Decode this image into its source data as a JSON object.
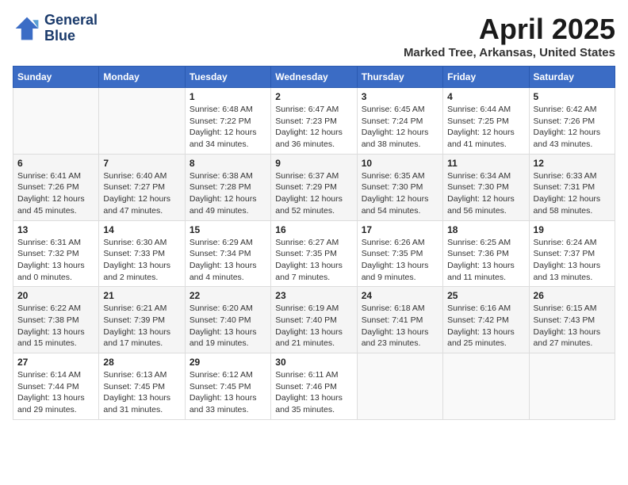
{
  "header": {
    "logo_line1": "General",
    "logo_line2": "Blue",
    "month_title": "April 2025",
    "location": "Marked Tree, Arkansas, United States"
  },
  "weekdays": [
    "Sunday",
    "Monday",
    "Tuesday",
    "Wednesday",
    "Thursday",
    "Friday",
    "Saturday"
  ],
  "weeks": [
    [
      {
        "day": null,
        "sunrise": null,
        "sunset": null,
        "daylight": null
      },
      {
        "day": null,
        "sunrise": null,
        "sunset": null,
        "daylight": null
      },
      {
        "day": "1",
        "sunrise": "Sunrise: 6:48 AM",
        "sunset": "Sunset: 7:22 PM",
        "daylight": "Daylight: 12 hours and 34 minutes."
      },
      {
        "day": "2",
        "sunrise": "Sunrise: 6:47 AM",
        "sunset": "Sunset: 7:23 PM",
        "daylight": "Daylight: 12 hours and 36 minutes."
      },
      {
        "day": "3",
        "sunrise": "Sunrise: 6:45 AM",
        "sunset": "Sunset: 7:24 PM",
        "daylight": "Daylight: 12 hours and 38 minutes."
      },
      {
        "day": "4",
        "sunrise": "Sunrise: 6:44 AM",
        "sunset": "Sunset: 7:25 PM",
        "daylight": "Daylight: 12 hours and 41 minutes."
      },
      {
        "day": "5",
        "sunrise": "Sunrise: 6:42 AM",
        "sunset": "Sunset: 7:26 PM",
        "daylight": "Daylight: 12 hours and 43 minutes."
      }
    ],
    [
      {
        "day": "6",
        "sunrise": "Sunrise: 6:41 AM",
        "sunset": "Sunset: 7:26 PM",
        "daylight": "Daylight: 12 hours and 45 minutes."
      },
      {
        "day": "7",
        "sunrise": "Sunrise: 6:40 AM",
        "sunset": "Sunset: 7:27 PM",
        "daylight": "Daylight: 12 hours and 47 minutes."
      },
      {
        "day": "8",
        "sunrise": "Sunrise: 6:38 AM",
        "sunset": "Sunset: 7:28 PM",
        "daylight": "Daylight: 12 hours and 49 minutes."
      },
      {
        "day": "9",
        "sunrise": "Sunrise: 6:37 AM",
        "sunset": "Sunset: 7:29 PM",
        "daylight": "Daylight: 12 hours and 52 minutes."
      },
      {
        "day": "10",
        "sunrise": "Sunrise: 6:35 AM",
        "sunset": "Sunset: 7:30 PM",
        "daylight": "Daylight: 12 hours and 54 minutes."
      },
      {
        "day": "11",
        "sunrise": "Sunrise: 6:34 AM",
        "sunset": "Sunset: 7:30 PM",
        "daylight": "Daylight: 12 hours and 56 minutes."
      },
      {
        "day": "12",
        "sunrise": "Sunrise: 6:33 AM",
        "sunset": "Sunset: 7:31 PM",
        "daylight": "Daylight: 12 hours and 58 minutes."
      }
    ],
    [
      {
        "day": "13",
        "sunrise": "Sunrise: 6:31 AM",
        "sunset": "Sunset: 7:32 PM",
        "daylight": "Daylight: 13 hours and 0 minutes."
      },
      {
        "day": "14",
        "sunrise": "Sunrise: 6:30 AM",
        "sunset": "Sunset: 7:33 PM",
        "daylight": "Daylight: 13 hours and 2 minutes."
      },
      {
        "day": "15",
        "sunrise": "Sunrise: 6:29 AM",
        "sunset": "Sunset: 7:34 PM",
        "daylight": "Daylight: 13 hours and 4 minutes."
      },
      {
        "day": "16",
        "sunrise": "Sunrise: 6:27 AM",
        "sunset": "Sunset: 7:35 PM",
        "daylight": "Daylight: 13 hours and 7 minutes."
      },
      {
        "day": "17",
        "sunrise": "Sunrise: 6:26 AM",
        "sunset": "Sunset: 7:35 PM",
        "daylight": "Daylight: 13 hours and 9 minutes."
      },
      {
        "day": "18",
        "sunrise": "Sunrise: 6:25 AM",
        "sunset": "Sunset: 7:36 PM",
        "daylight": "Daylight: 13 hours and 11 minutes."
      },
      {
        "day": "19",
        "sunrise": "Sunrise: 6:24 AM",
        "sunset": "Sunset: 7:37 PM",
        "daylight": "Daylight: 13 hours and 13 minutes."
      }
    ],
    [
      {
        "day": "20",
        "sunrise": "Sunrise: 6:22 AM",
        "sunset": "Sunset: 7:38 PM",
        "daylight": "Daylight: 13 hours and 15 minutes."
      },
      {
        "day": "21",
        "sunrise": "Sunrise: 6:21 AM",
        "sunset": "Sunset: 7:39 PM",
        "daylight": "Daylight: 13 hours and 17 minutes."
      },
      {
        "day": "22",
        "sunrise": "Sunrise: 6:20 AM",
        "sunset": "Sunset: 7:40 PM",
        "daylight": "Daylight: 13 hours and 19 minutes."
      },
      {
        "day": "23",
        "sunrise": "Sunrise: 6:19 AM",
        "sunset": "Sunset: 7:40 PM",
        "daylight": "Daylight: 13 hours and 21 minutes."
      },
      {
        "day": "24",
        "sunrise": "Sunrise: 6:18 AM",
        "sunset": "Sunset: 7:41 PM",
        "daylight": "Daylight: 13 hours and 23 minutes."
      },
      {
        "day": "25",
        "sunrise": "Sunrise: 6:16 AM",
        "sunset": "Sunset: 7:42 PM",
        "daylight": "Daylight: 13 hours and 25 minutes."
      },
      {
        "day": "26",
        "sunrise": "Sunrise: 6:15 AM",
        "sunset": "Sunset: 7:43 PM",
        "daylight": "Daylight: 13 hours and 27 minutes."
      }
    ],
    [
      {
        "day": "27",
        "sunrise": "Sunrise: 6:14 AM",
        "sunset": "Sunset: 7:44 PM",
        "daylight": "Daylight: 13 hours and 29 minutes."
      },
      {
        "day": "28",
        "sunrise": "Sunrise: 6:13 AM",
        "sunset": "Sunset: 7:45 PM",
        "daylight": "Daylight: 13 hours and 31 minutes."
      },
      {
        "day": "29",
        "sunrise": "Sunrise: 6:12 AM",
        "sunset": "Sunset: 7:45 PM",
        "daylight": "Daylight: 13 hours and 33 minutes."
      },
      {
        "day": "30",
        "sunrise": "Sunrise: 6:11 AM",
        "sunset": "Sunset: 7:46 PM",
        "daylight": "Daylight: 13 hours and 35 minutes."
      },
      {
        "day": null,
        "sunrise": null,
        "sunset": null,
        "daylight": null
      },
      {
        "day": null,
        "sunrise": null,
        "sunset": null,
        "daylight": null
      },
      {
        "day": null,
        "sunrise": null,
        "sunset": null,
        "daylight": null
      }
    ]
  ]
}
